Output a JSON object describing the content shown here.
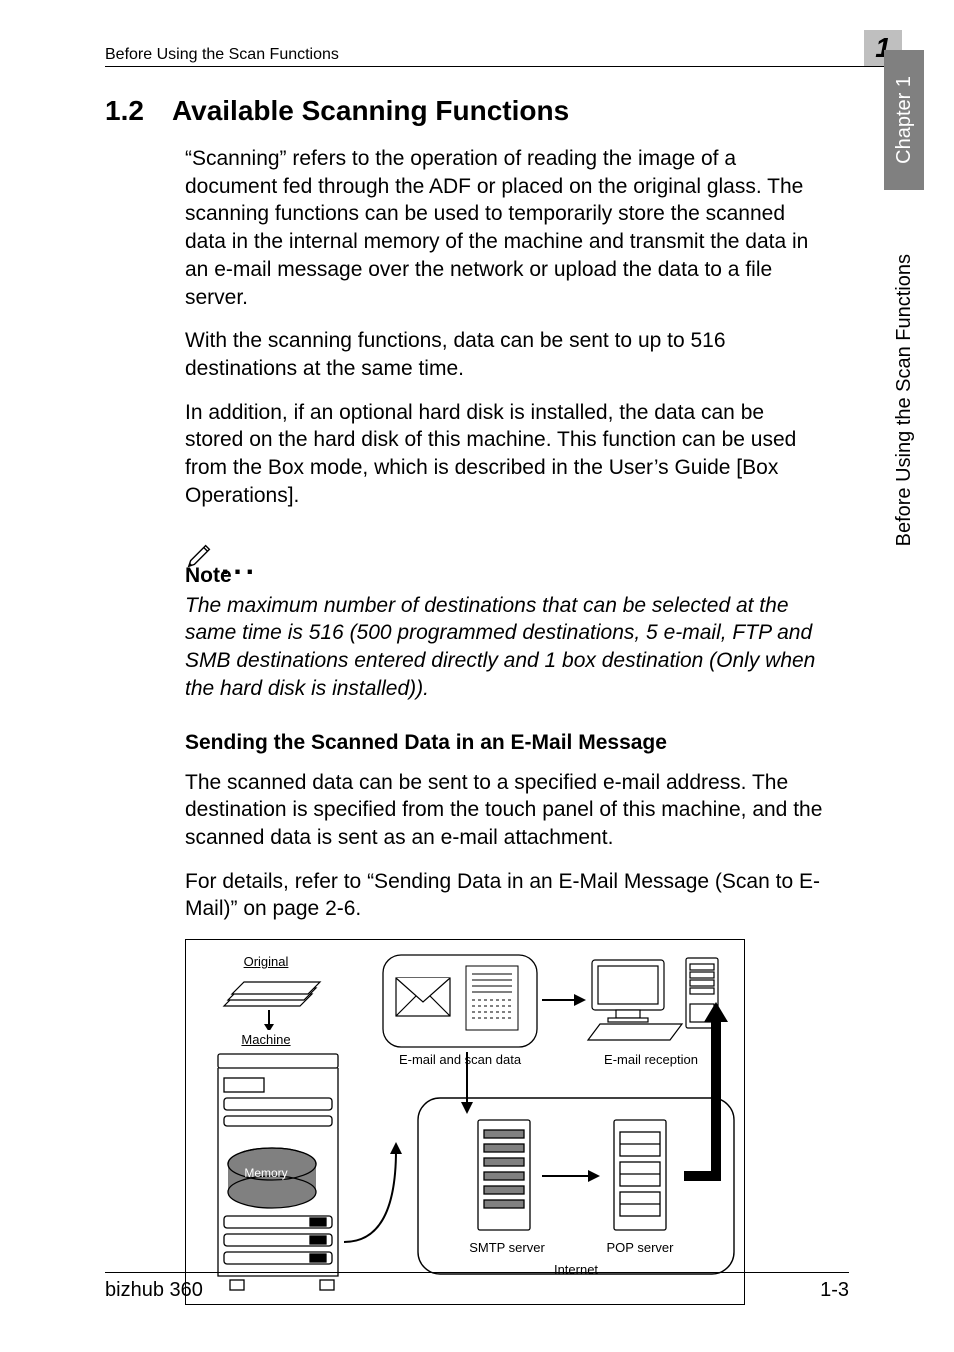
{
  "header": {
    "running": "Before Using the Scan Functions",
    "chapterNum": "1"
  },
  "sidebar": {
    "tab": "Chapter 1",
    "label": "Before Using the Scan Functions"
  },
  "section": {
    "number": "1.2",
    "title": "Available Scanning Functions"
  },
  "paragraphs": {
    "p1": "“Scanning” refers to the operation of reading the image of a document fed through the ADF or placed on the original glass. The scanning functions can be used to temporarily store the scanned data in the internal memory of the machine and transmit the data in an e-mail message over the network or upload the data to a file server.",
    "p2": "With the scanning functions, data can be sent to up to 516 destinations at the same time.",
    "p3": "In addition, if an optional hard disk is installed, the data can be stored on the hard disk of this machine. This function can be used from the Box mode, which is described in the User’s Guide [Box Operations]."
  },
  "note": {
    "label": "Note",
    "body": "The maximum number of destinations that can be selected at the same time is 516 (500 programmed destinations, 5 e-mail, FTP and SMB destinations entered directly and 1 box destination (Only when the hard disk is installed))."
  },
  "subsection": {
    "title": "Sending the Scanned Data in an E-Mail Message",
    "p1": "The scanned data can be sent to a specified e-mail address. The destination is specified from the touch panel of this machine, and the scanned data is sent as an e-mail attachment.",
    "p2": "For details, refer to “Sending Data in an E-Mail Message (Scan to E-Mail)” on page 2-6."
  },
  "diagram": {
    "original": "Original",
    "machine": "Machine",
    "memory": "Memory",
    "emailScan": "E-mail and scan data",
    "emailReception": "E-mail reception",
    "smtp": "SMTP server",
    "pop": "POP server",
    "internet": "Internet"
  },
  "footer": {
    "left": "bizhub 360",
    "right": "1-3"
  }
}
